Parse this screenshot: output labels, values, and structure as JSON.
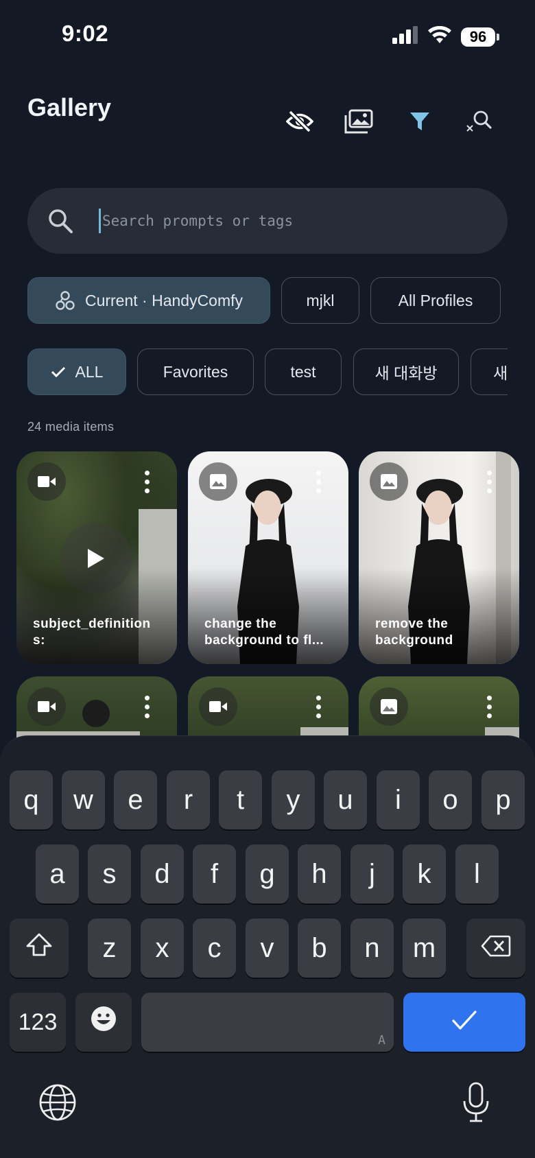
{
  "status_bar": {
    "time": "9:02",
    "battery": "96"
  },
  "header": {
    "title": "Gallery",
    "icons": [
      "eye-off-icon",
      "images-icon",
      "filter-icon",
      "search-clear-icon"
    ]
  },
  "search": {
    "placeholder": "Search prompts or tags",
    "value": ""
  },
  "profile_chips": [
    {
      "label": "Current · HandyComfy",
      "selected": true
    },
    {
      "label": "mjkl",
      "selected": false
    },
    {
      "label": "All Profiles",
      "selected": false
    }
  ],
  "album_chips": [
    {
      "label": "ALL",
      "selected": true
    },
    {
      "label": "Favorites",
      "selected": false
    },
    {
      "label": "test",
      "selected": false
    },
    {
      "label": "새 대화방",
      "selected": false
    },
    {
      "label": "새",
      "selected": false
    }
  ],
  "media_count": "24 media items",
  "media": [
    {
      "type": "video",
      "caption": "subject_definition s:"
    },
    {
      "type": "image",
      "caption": "change the background to fl..."
    },
    {
      "type": "image",
      "caption": "remove the background"
    },
    {
      "type": "video",
      "caption": ""
    },
    {
      "type": "video",
      "caption": ""
    },
    {
      "type": "image",
      "caption": ""
    }
  ],
  "keyboard": {
    "row1": [
      "q",
      "w",
      "e",
      "r",
      "t",
      "y",
      "u",
      "i",
      "o",
      "p"
    ],
    "row2": [
      "a",
      "s",
      "d",
      "f",
      "g",
      "h",
      "j",
      "k",
      "l"
    ],
    "row3": [
      "z",
      "x",
      "c",
      "v",
      "b",
      "n",
      "m"
    ],
    "numbers_key": "123",
    "space_hint": "A",
    "accent_color": "#2f74ee"
  }
}
